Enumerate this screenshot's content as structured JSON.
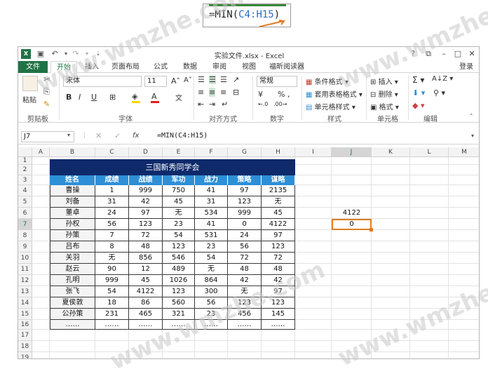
{
  "callout": {
    "prefix": "=MIN(",
    "ref": "C4:H15",
    "suffix": ")"
  },
  "window": {
    "title": "实验文件.xlsx - Excel",
    "controls": [
      "?",
      "⧉",
      "–",
      "□",
      "✕"
    ],
    "login": "登录"
  },
  "tabs": [
    "文件",
    "开始",
    "插入",
    "页面布局",
    "公式",
    "数据",
    "审阅",
    "视图",
    "福昕阅读器"
  ],
  "active_tab": "开始",
  "ribbon": {
    "clipboard": {
      "label": "剪贴板",
      "paste": "粘贴"
    },
    "font": {
      "label": "字体",
      "name": "宋体",
      "size": "11",
      "bold": "B",
      "italic": "I",
      "underline": "U"
    },
    "alignment": {
      "label": "对齐方式"
    },
    "number": {
      "label": "数字",
      "format": "常规",
      "currency": "¥",
      "percent": "%",
      "comma": ","
    },
    "styles": {
      "label": "样式",
      "items": [
        "条件格式",
        "套用表格格式",
        "单元格样式"
      ]
    },
    "cells": {
      "label": "单元格",
      "items": [
        "插入",
        "删除",
        "格式"
      ]
    },
    "editing": {
      "label": "编辑"
    }
  },
  "formula_bar": {
    "cell": "J7",
    "formula": "=MIN(C4:H15)",
    "fx": "fx"
  },
  "columns": [
    "A",
    "B",
    "C",
    "D",
    "E",
    "F",
    "G",
    "H",
    "I",
    "J",
    "K",
    "L",
    "M"
  ],
  "rows": [
    "1",
    "2",
    "3",
    "4",
    "5",
    "6",
    "7",
    "8",
    "9",
    "10",
    "11",
    "12",
    "13",
    "14",
    "15",
    "16",
    "17",
    "18",
    "19"
  ],
  "table": {
    "title": "三国新秀同学会",
    "headers": [
      "姓名",
      "成绩",
      "战绩",
      "军功",
      "战力",
      "策略",
      "谋略"
    ],
    "rows": [
      [
        "曹操",
        "1",
        "999",
        "750",
        "41",
        "97",
        "2135"
      ],
      [
        "刘备",
        "31",
        "42",
        "45",
        "31",
        "123",
        "无"
      ],
      [
        "董卓",
        "24",
        "97",
        "无",
        "534",
        "999",
        "45"
      ],
      [
        "孙权",
        "56",
        "123",
        "23",
        "41",
        "0",
        "4122"
      ],
      [
        "孙策",
        "7",
        "72",
        "54",
        "531",
        "24",
        "97"
      ],
      [
        "吕布",
        "8",
        "48",
        "123",
        "23",
        "56",
        "123"
      ],
      [
        "关羽",
        "无",
        "856",
        "546",
        "54",
        "72",
        "72"
      ],
      [
        "赵云",
        "90",
        "12",
        "489",
        "无",
        "48",
        "48"
      ],
      [
        "孔明",
        "999",
        "45",
        "1026",
        "864",
        "42",
        "42"
      ],
      [
        "张飞",
        "54",
        "4122",
        "123",
        "300",
        "无",
        "97"
      ],
      [
        "夏侯敦",
        "18",
        "86",
        "560",
        "56",
        "123",
        "123"
      ],
      [
        "公孙策",
        "231",
        "465",
        "321",
        "23",
        "456",
        "145"
      ],
      [
        "……",
        "……",
        "……",
        "……",
        "……",
        "……",
        "……"
      ]
    ]
  },
  "cells": {
    "J6": "4122",
    "J7": "0"
  },
  "watermark": "www.wmzhe.com"
}
